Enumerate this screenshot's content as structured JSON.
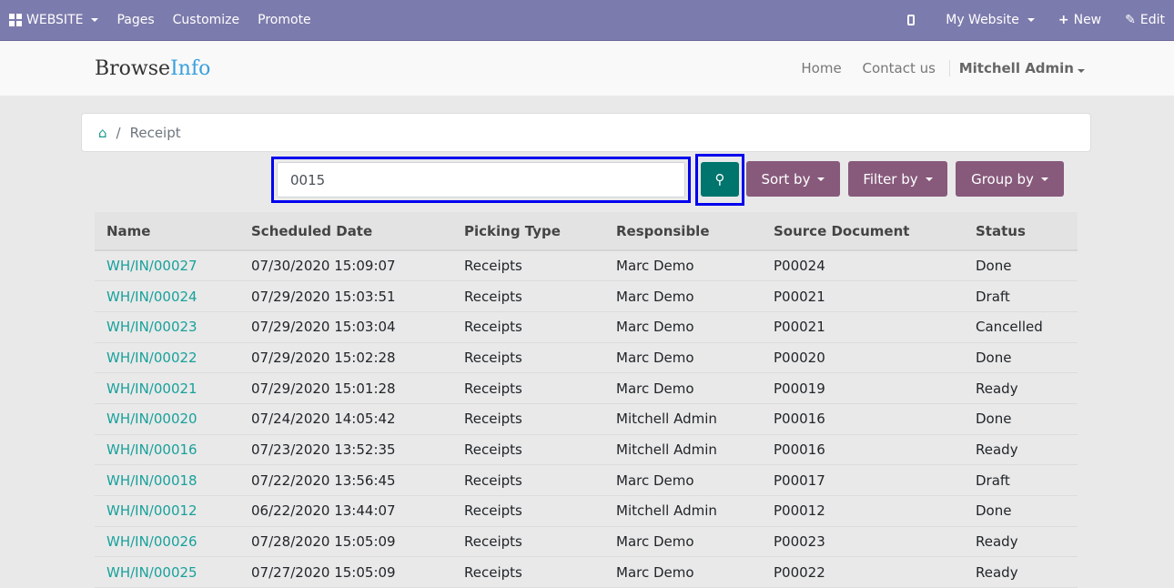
{
  "topbar": {
    "website": "WEBSITE",
    "pages": "Pages",
    "customize": "Customize",
    "promote": "Promote",
    "my_website": "My Website",
    "new": "New",
    "edit": "Edit"
  },
  "header": {
    "logo_a": "Browse",
    "logo_b": "Info",
    "home": "Home",
    "contact": "Contact us",
    "user": "Mitchell Admin"
  },
  "breadcrumb": {
    "current": "Receipt"
  },
  "search": {
    "value": "0015"
  },
  "buttons": {
    "sort": "Sort by",
    "filter": "Filter by",
    "group": "Group by"
  },
  "table": {
    "headers": [
      "Name",
      "Scheduled Date",
      "Picking Type",
      "Responsible",
      "Source Document",
      "Status"
    ],
    "rows": [
      [
        "WH/IN/00027",
        "07/30/2020 15:09:07",
        "Receipts",
        "Marc Demo",
        "P00024",
        "Done"
      ],
      [
        "WH/IN/00024",
        "07/29/2020 15:03:51",
        "Receipts",
        "Marc Demo",
        "P00021",
        "Draft"
      ],
      [
        "WH/IN/00023",
        "07/29/2020 15:03:04",
        "Receipts",
        "Marc Demo",
        "P00021",
        "Cancelled"
      ],
      [
        "WH/IN/00022",
        "07/29/2020 15:02:28",
        "Receipts",
        "Marc Demo",
        "P00020",
        "Done"
      ],
      [
        "WH/IN/00021",
        "07/29/2020 15:01:28",
        "Receipts",
        "Marc Demo",
        "P00019",
        "Ready"
      ],
      [
        "WH/IN/00020",
        "07/24/2020 14:05:42",
        "Receipts",
        "Mitchell Admin",
        "P00016",
        "Done"
      ],
      [
        "WH/IN/00016",
        "07/23/2020 13:52:35",
        "Receipts",
        "Mitchell Admin",
        "P00016",
        "Ready"
      ],
      [
        "WH/IN/00018",
        "07/22/2020 13:56:45",
        "Receipts",
        "Marc Demo",
        "P00017",
        "Draft"
      ],
      [
        "WH/IN/00012",
        "06/22/2020 13:44:07",
        "Receipts",
        "Mitchell Admin",
        "P00012",
        "Done"
      ],
      [
        "WH/IN/00026",
        "07/28/2020 15:05:09",
        "Receipts",
        "Marc Demo",
        "P00023",
        "Ready"
      ],
      [
        "WH/IN/00025",
        "07/27/2020 15:05:09",
        "Receipts",
        "Marc Demo",
        "P00022",
        "Ready"
      ]
    ]
  }
}
